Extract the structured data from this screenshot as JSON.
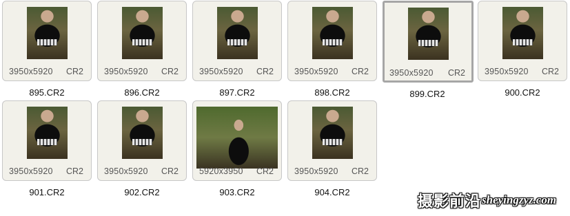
{
  "files": [
    {
      "name": "895.CR2",
      "dimensions": "3950x5920",
      "type": "CR2",
      "orientation": "portrait",
      "selected": false
    },
    {
      "name": "896.CR2",
      "dimensions": "3950x5920",
      "type": "CR2",
      "orientation": "portrait",
      "selected": false
    },
    {
      "name": "897.CR2",
      "dimensions": "3950x5920",
      "type": "CR2",
      "orientation": "portrait",
      "selected": false
    },
    {
      "name": "898.CR2",
      "dimensions": "3950x5920",
      "type": "CR2",
      "orientation": "portrait",
      "selected": false
    },
    {
      "name": "899.CR2",
      "dimensions": "3950x5920",
      "type": "CR2",
      "orientation": "portrait",
      "selected": true
    },
    {
      "name": "900.CR2",
      "dimensions": "3950x5920",
      "type": "CR2",
      "orientation": "portrait",
      "selected": false
    },
    {
      "name": "901.CR2",
      "dimensions": "3950x5920",
      "type": "CR2",
      "orientation": "portrait",
      "selected": false
    },
    {
      "name": "902.CR2",
      "dimensions": "3950x5920",
      "type": "CR2",
      "orientation": "portrait",
      "selected": false
    },
    {
      "name": "903.CR2",
      "dimensions": "5920x3950",
      "type": "CR2",
      "orientation": "landscape",
      "selected": false
    },
    {
      "name": "904.CR2",
      "dimensions": "3950x5920",
      "type": "CR2",
      "orientation": "portrait",
      "selected": false
    }
  ],
  "watermark": {
    "chinese": "摄影前沿",
    "domain": "sheyingzyz.com"
  }
}
